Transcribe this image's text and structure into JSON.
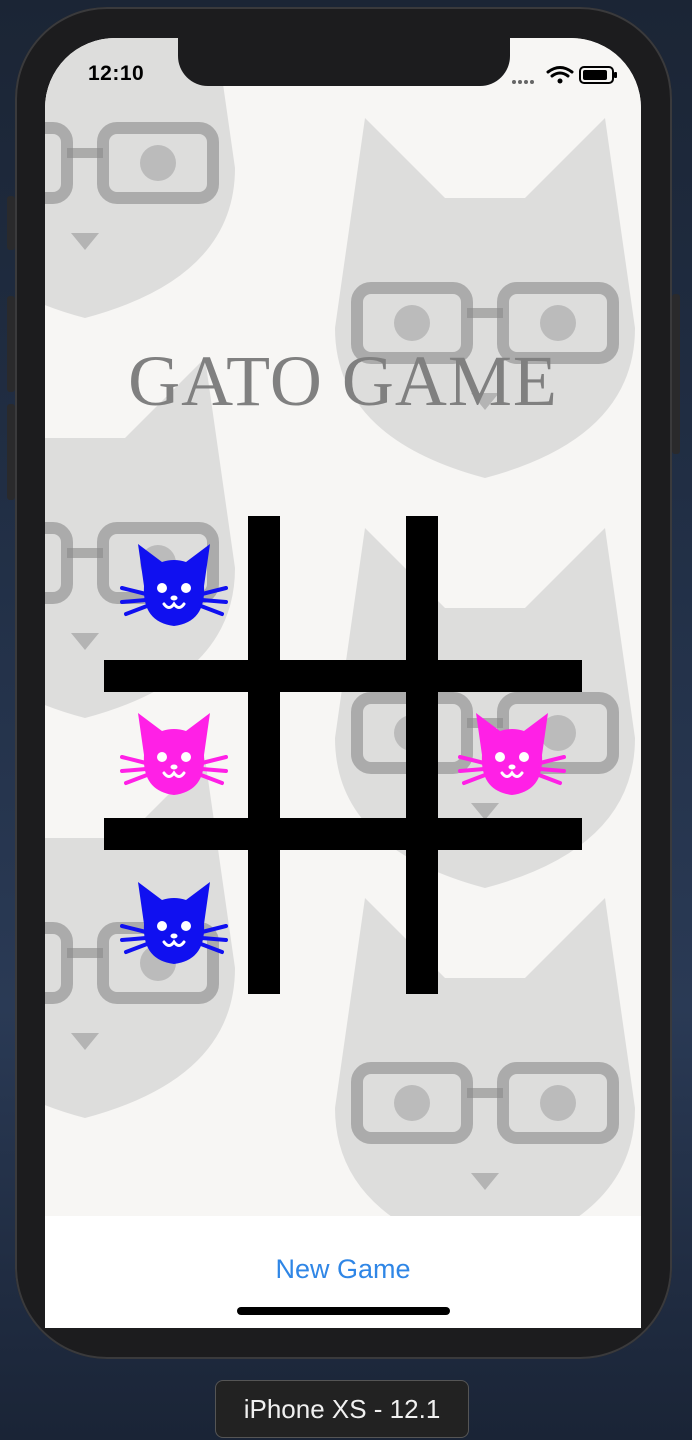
{
  "status_bar": {
    "time": "12:10"
  },
  "game": {
    "title": "GATO GAME",
    "colors": {
      "player_one": "#1010f0",
      "player_two": "#ff20e6",
      "grid": "#000000"
    },
    "board": [
      [
        "blue-cat",
        "",
        ""
      ],
      [
        "pink-cat",
        "",
        "pink-cat"
      ],
      [
        "blue-cat",
        "",
        ""
      ]
    ]
  },
  "toolbar": {
    "new_game_label": "New Game"
  },
  "simulator": {
    "device_label": "iPhone XS - 12.1"
  }
}
